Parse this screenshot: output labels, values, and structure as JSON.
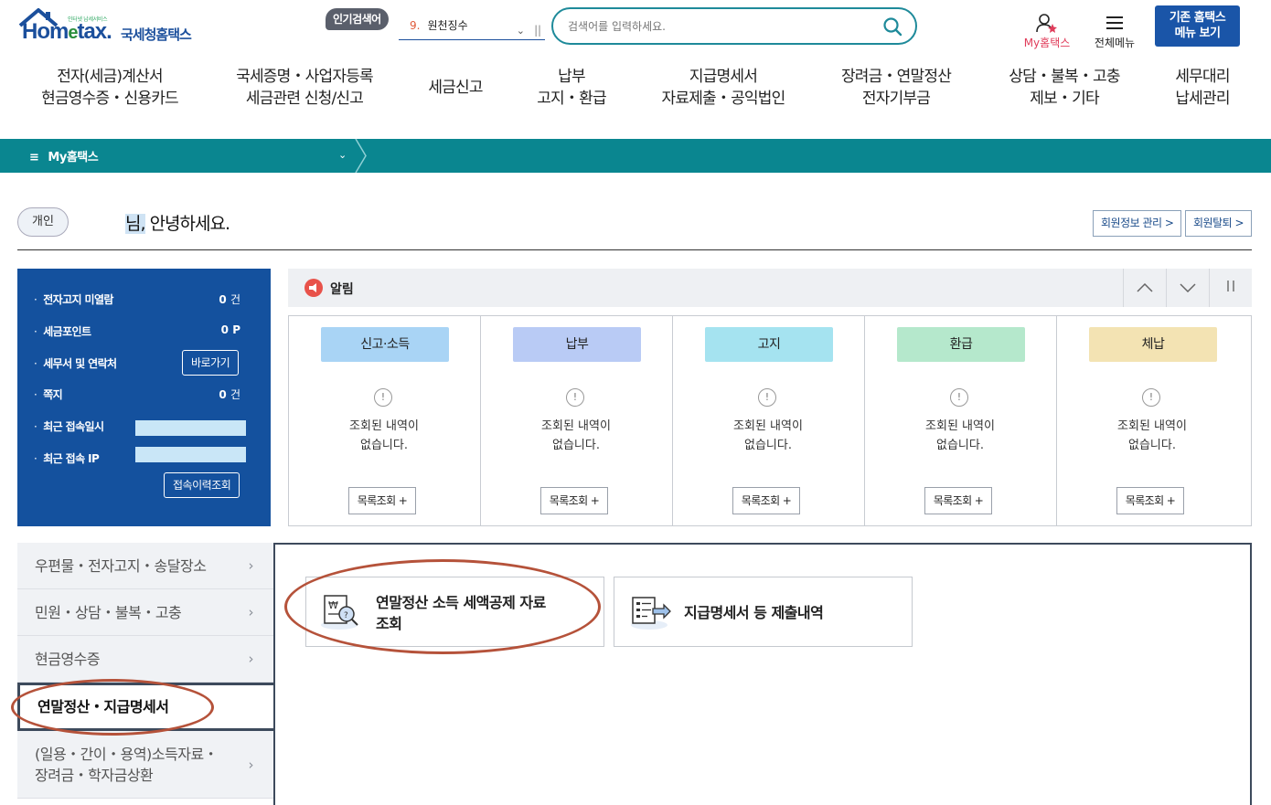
{
  "brand": {
    "tagline": "인터넷 납세서비스",
    "name_en_prefix": "Hom",
    "name_en_e": "e",
    "name_en_suffix": "tax.",
    "name_kr": "국세청홈택스"
  },
  "header": {
    "popular_label": "인기검색어",
    "popular_rank": "9.",
    "popular_term": "원천징수",
    "search_placeholder": "검색어를 입력하세요.",
    "my_hometax": "My홈택스",
    "all_menu": "전체메뉴",
    "old_hometax": "기존 홈택스\n메뉴 보기"
  },
  "gnb": [
    "전자(세금)계산서\n현금영수증・신용카드",
    "국세증명・사업자등록\n세금관련 신청/신고",
    "세금신고",
    "납부\n고지・환급",
    "지급명세서\n자료제출・공익법인",
    "장려금・연말정산\n전자기부금",
    "상담・불복・고충\n제보・기타",
    "세무대리\n납세관리"
  ],
  "breadcrumb_bar": {
    "label": "My홈택스"
  },
  "greeting": {
    "user_type": "개인",
    "name_suffix": "님,",
    "message": " 안녕하세요.",
    "member_info_button": "회원정보 관리 >",
    "withdraw_button": "회원탈퇴 >"
  },
  "info_box": {
    "e_notice_label": "전자고지 미열람",
    "e_notice_value": "0",
    "e_notice_unit": "건",
    "points_label": "세금포인트",
    "points_value": "0",
    "points_unit": "P",
    "office_label": "세무서 및 연락처",
    "office_button": "바로가기",
    "memo_label": "쪽지",
    "memo_value": "0",
    "memo_unit": "건",
    "last_login_label": "최근 접속일시",
    "last_ip_label": "최근 접속 IP",
    "history_button": "접속이력조회"
  },
  "notice": {
    "title": "알림",
    "columns": [
      {
        "tag": "신고·소득",
        "color": "#a9d4f5",
        "message": "조회된 내역이\n없습니다.",
        "button": "목록조회 +"
      },
      {
        "tag": "납부",
        "color": "#b9cbf5",
        "message": "조회된 내역이\n없습니다.",
        "button": "목록조회 +"
      },
      {
        "tag": "고지",
        "color": "#a5e3f0",
        "message": "조회된 내역이\n없습니다.",
        "button": "목록조회 +"
      },
      {
        "tag": "환급",
        "color": "#b5e8cc",
        "message": "조회된 내역이\n없습니다.",
        "button": "목록조회 +"
      },
      {
        "tag": "체납",
        "color": "#f3e3b3",
        "message": "조회된 내역이\n없습니다.",
        "button": "목록조회 +"
      }
    ]
  },
  "left_menu": [
    {
      "label": "우편물・전자고지・송달장소"
    },
    {
      "label": "민원・상담・불복・고충"
    },
    {
      "label": "현금영수증"
    },
    {
      "label": "연말정산・지급명세서"
    },
    {
      "label": "(일용・간이・용역)소득자료・\n장려금・학자금상환"
    }
  ],
  "content_cards": [
    {
      "label": "연말정산 소득 세액공제 자료\n조회",
      "icon": "tax-deduction-search-icon"
    },
    {
      "label": "지급명세서 등 제출내역",
      "icon": "payment-statement-icon"
    }
  ],
  "colors": {
    "teal_bar": "#0a8690",
    "brand_blue": "#14519e",
    "annotation_ellipse": "#b5523a"
  }
}
